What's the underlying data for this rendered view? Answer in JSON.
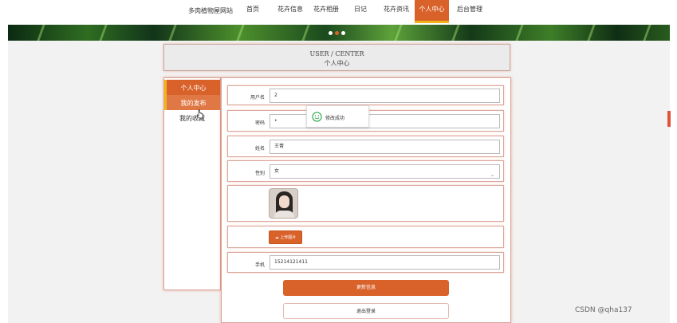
{
  "header": {
    "site_name": "多肉植物屋网站",
    "nav": [
      {
        "label": "首页"
      },
      {
        "label": "花卉信息"
      },
      {
        "label": "花卉相册"
      },
      {
        "label": "日记"
      },
      {
        "label": "花卉资讯"
      },
      {
        "label": "个人中心",
        "active": true
      },
      {
        "label": "后台管理"
      }
    ]
  },
  "banner": {
    "dots_count": 3,
    "active_dot": 1
  },
  "page_title": {
    "en": "USER / CENTER",
    "cn": "个人中心"
  },
  "sidebar": {
    "items": [
      {
        "label": "个人中心",
        "state": "active"
      },
      {
        "label": "我的发布",
        "state": "hover"
      },
      {
        "label": "我的收藏",
        "state": "normal"
      }
    ]
  },
  "form": {
    "username": {
      "label": "用户名",
      "value": "2"
    },
    "password": {
      "label": "密码",
      "value": "•"
    },
    "name": {
      "label": "姓名",
      "value": "王菁"
    },
    "gender": {
      "label": "性别",
      "value": "女"
    },
    "upload_label": "上传图片",
    "phone": {
      "label": "手机",
      "value": "15214121411"
    },
    "update_label": "更新信息",
    "logout_label": "退出登录"
  },
  "toast": {
    "text": "修改成功",
    "icon": "smile-icon"
  },
  "watermark": "CSDN @qha137",
  "colors": {
    "accent": "#d9622b",
    "highlight": "#f0b51a",
    "toast_icon": "#2fa84f"
  }
}
